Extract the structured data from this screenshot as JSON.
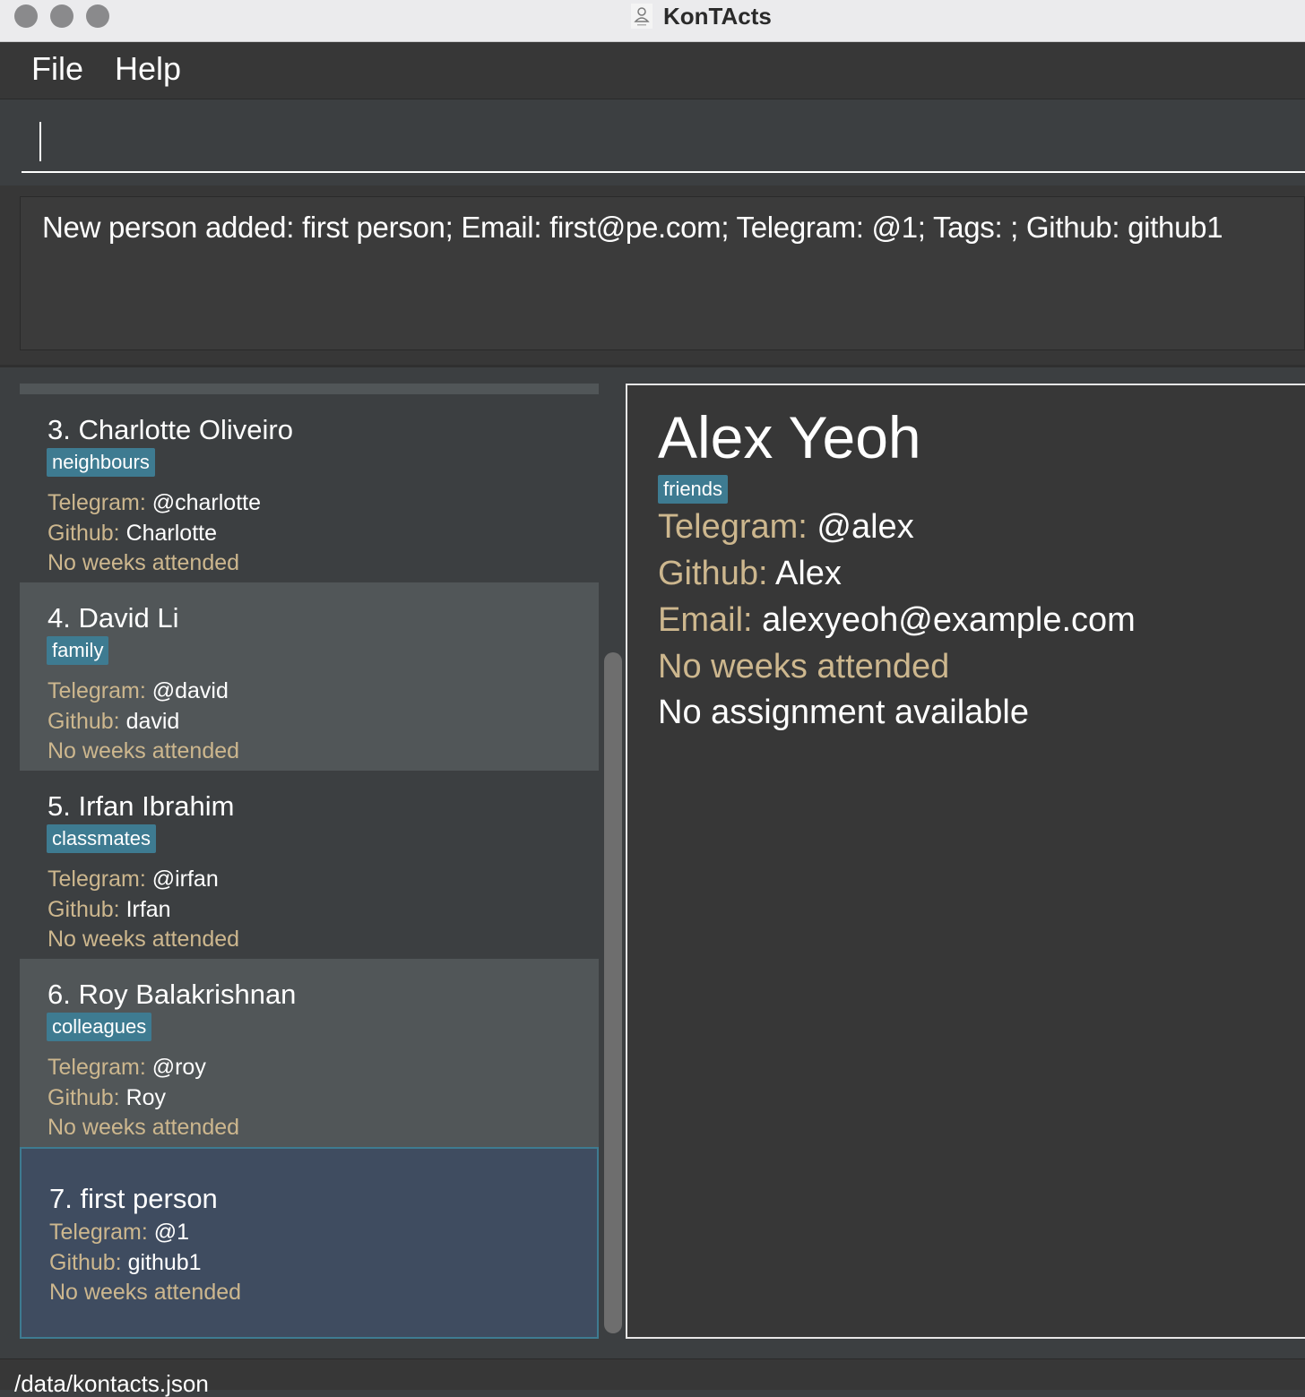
{
  "window": {
    "title": "KonTActs"
  },
  "menu": {
    "file": "File",
    "help": "Help"
  },
  "command": {
    "value": "",
    "placeholder": ""
  },
  "result": {
    "text": "New person added: first person; Email: first@pe.com; Telegram: @1; Tags: ; Github: github1"
  },
  "labels": {
    "telegram": "Telegram:",
    "github": "Github:",
    "email": "Email:"
  },
  "persons": [
    {
      "name": "3. Charlotte Oliveiro",
      "tag": "neighbours",
      "telegram": "@charlotte",
      "github": "Charlotte",
      "weeks": "No weeks attended"
    },
    {
      "name": "4. David Li",
      "tag": "family",
      "telegram": "@david",
      "github": "david",
      "weeks": "No weeks attended"
    },
    {
      "name": "5. Irfan Ibrahim",
      "tag": "classmates",
      "telegram": "@irfan",
      "github": "Irfan",
      "weeks": "No weeks attended"
    },
    {
      "name": "6. Roy Balakrishnan",
      "tag": "colleagues",
      "telegram": "@roy",
      "github": "Roy",
      "weeks": "No weeks attended"
    },
    {
      "name": "7. first person",
      "tag": "",
      "telegram": "@1",
      "github": "github1",
      "weeks": "No weeks attended",
      "selected": true
    }
  ],
  "detail": {
    "name": "Alex Yeoh",
    "tag": "friends",
    "telegram": "@alex",
    "github": "Alex",
    "email": "alexyeoh@example.com",
    "weeks": "No weeks attended",
    "assignment": "No assignment available"
  },
  "status": {
    "path": "/data/kontacts.json"
  },
  "colors": {
    "background": "#3c3f41",
    "card_alt": "#515658",
    "card_selected": "#3f4c60",
    "selected_border": "#3e7b91",
    "tag": "#3e7b91",
    "label": "#cdb78e",
    "text": "#ffffff"
  }
}
